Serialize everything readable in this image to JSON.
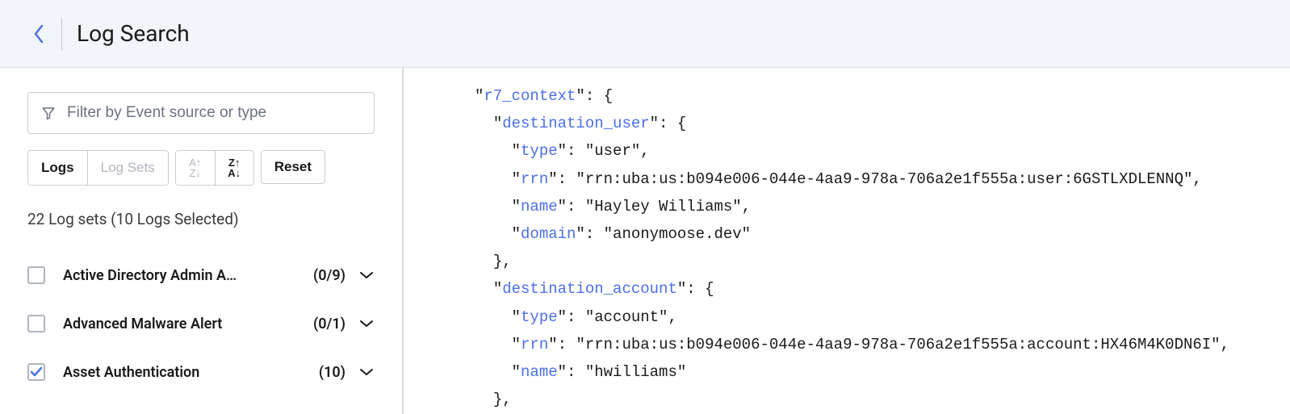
{
  "header": {
    "title": "Log Search"
  },
  "sidebar": {
    "filter_placeholder": "Filter by Event source or type",
    "tabs": {
      "logs": "Logs",
      "log_sets": "Log Sets"
    },
    "reset": "Reset",
    "summary": "22 Log sets (10 Logs Selected)",
    "logsets": [
      {
        "name": "Active Directory Admin A…",
        "count": "(0/9)",
        "checked": false
      },
      {
        "name": "Advanced Malware Alert",
        "count": "(0/1)",
        "checked": false
      },
      {
        "name": "Asset Authentication",
        "count": "(10)",
        "checked": true
      }
    ]
  },
  "json_view": {
    "r7_context": {
      "destination_user": {
        "type": "user",
        "rrn": "rrn:uba:us:b094e006-044e-4aa9-978a-706a2e1f555a:user:6GSTLXDLENNQ",
        "name": "Hayley Williams",
        "domain": "anonymoose.dev"
      },
      "destination_account": {
        "type": "account",
        "rrn": "rrn:uba:us:b094e006-044e-4aa9-978a-706a2e1f555a:account:HX46M4K0DN6I",
        "name": "hwilliams"
      }
    }
  }
}
